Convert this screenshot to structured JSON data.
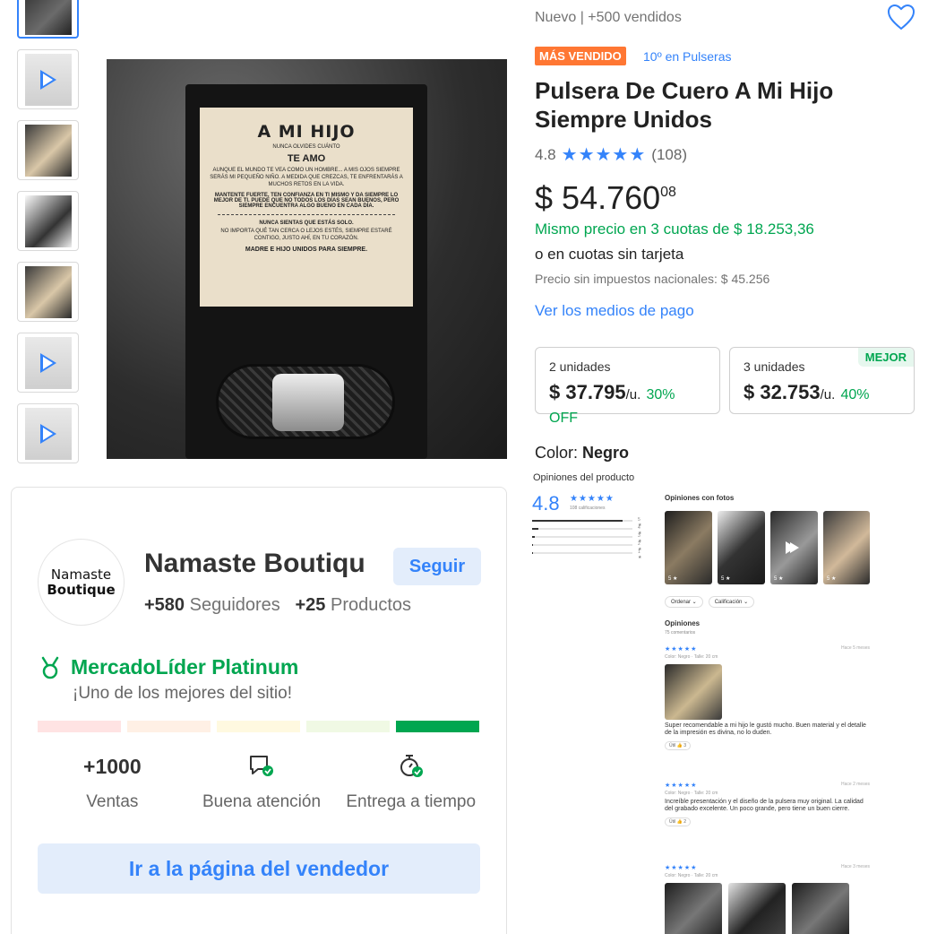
{
  "gallery": {
    "thumbnails": [
      "image",
      "video",
      "image",
      "image",
      "image",
      "video",
      "video"
    ],
    "main_card": {
      "heading": "A MI HIJO",
      "line1": "NUNCA OLVIDES CUÁNTO",
      "heading2": "TE AMO",
      "para1": "AUNQUE EL MUNDO TE VEA COMO UN HOMBRE... A MIS OJOS SIEMPRE SERÁS MI PEQUEÑO NIÑO. A MEDIDA QUE CREZCAS, TE ENFRENTARÁS A MUCHOS RETOS EN LA VIDA.",
      "para2": "MANTENTE FUERTE, TEN CONFIANZA EN TI MISMO Y DA SIEMPRE LO MEJOR DE TI. PUEDE QUE NO TODOS LOS DÍAS SEAN BUENOS, PERO SIEMPRE ENCUENTRA ALGO BUENO EN CADA DÍA.",
      "para3": "NUNCA SIENTAS QUE ESTÁS SOLO.",
      "para4": "NO IMPORTA QUÉ TAN CERCA O LEJOS ESTÉS, SIEMPRE ESTARÉ CONTIGO, JUSTO AHÍ, EN TU CORAZÓN.",
      "closing": "MADRE E HIJO UNIDOS PARA SIEMPRE."
    }
  },
  "product": {
    "condition": "Nuevo  |  +500 vendidos",
    "badge": "MÁS VENDIDO",
    "rank": "10º en Pulseras",
    "title": "Pulsera De Cuero A Mi Hijo Siempre Unidos",
    "rating": "4.8",
    "reviews_count": "(108)",
    "currency": "$",
    "price_int": "54.760",
    "price_dec": "08",
    "installments": "Mismo precio en 3 cuotas de $ 18.253,36",
    "no_card": "o en cuotas sin tarjeta",
    "tax": "Precio sin impuestos nacionales: $ 45.256",
    "payment_link": "Ver los medios de pago",
    "color_label": "Color: ",
    "color_value": "Negro"
  },
  "bulk": [
    {
      "units": "2 unidades",
      "price": "$ 37.795",
      "per": "/u.",
      "discount": "30% OFF",
      "tag": ""
    },
    {
      "units": "3 unidades",
      "price": "$ 32.753",
      "per": "/u.",
      "discount": "40%",
      "tag": "MEJOR"
    }
  ],
  "opinions": {
    "title": "Opiniones del producto",
    "avg": "4.8",
    "stars": "★★★★★",
    "califications": "108 calificaciones",
    "distribution": [
      {
        "label": "5 ★",
        "fraction": 0.9
      },
      {
        "label": "4 ★",
        "fraction": 0.06
      },
      {
        "label": "3 ★",
        "fraction": 0.03
      },
      {
        "label": "2 ★",
        "fraction": 0.01
      },
      {
        "label": "1 ★",
        "fraction": 0.01
      }
    ],
    "photos_title": "Opiniones con fotos",
    "photo_scores": [
      "5 ★",
      "5 ★",
      "5 ★",
      "5 ★"
    ],
    "filter_order": "Ordenar ⌄",
    "filter_rating": "Calificación ⌄",
    "list_title": "Opiniones",
    "list_count": "75 comentarios",
    "reviews": [
      {
        "stars": "★★★★★",
        "date": "Hace 5 meses",
        "meta": "Color: Negro · Talle: 20 cm",
        "text": "Super recomendable a mi hijo le gustó mucho. Buen material y el detalle de la impresión es divina, no lo duden.",
        "useful": "Útil 👍 3"
      },
      {
        "stars": "★★★★★",
        "date": "Hace 2 meses",
        "meta": "Color: Negro · Talle: 20 cm",
        "text": "Increíble presentación y el diseño de la pulsera muy original. La calidad del grabado excelente. Un poco grande, pero tiene un buen cierre.",
        "useful": "Útil 👍 2"
      },
      {
        "stars": "★★★★★",
        "date": "Hace 3 meses",
        "meta": "Color: Negro · Talle: 20 cm",
        "text": "",
        "useful": ""
      }
    ]
  },
  "seller": {
    "logo_line1": "Namaste",
    "logo_line2": "Boutique",
    "name": "Namaste Boutiqu",
    "follow": "Seguir",
    "followers_num": "+580",
    "followers_label": "Seguidores",
    "products_num": "+25",
    "products_label": "Productos",
    "leader_title": "MercadoLíder Platinum",
    "leader_sub": "¡Uno de los mejores del sitio!",
    "thermometer_level": 5,
    "thermometer_colors": [
      "#ffe3e3",
      "#fff0e5",
      "#fff9e0",
      "#f0f9e4",
      "#00a650"
    ],
    "metric_sales_value": "+1000",
    "metric_sales_label": "Ventas",
    "metric_attention_label": "Buena atención",
    "metric_delivery_label": "Entrega a tiempo",
    "go_button": "Ir a la página del vendedor"
  },
  "colors": {
    "accent": "#3483fa",
    "green": "#00a650",
    "badge": "#ff7733"
  }
}
